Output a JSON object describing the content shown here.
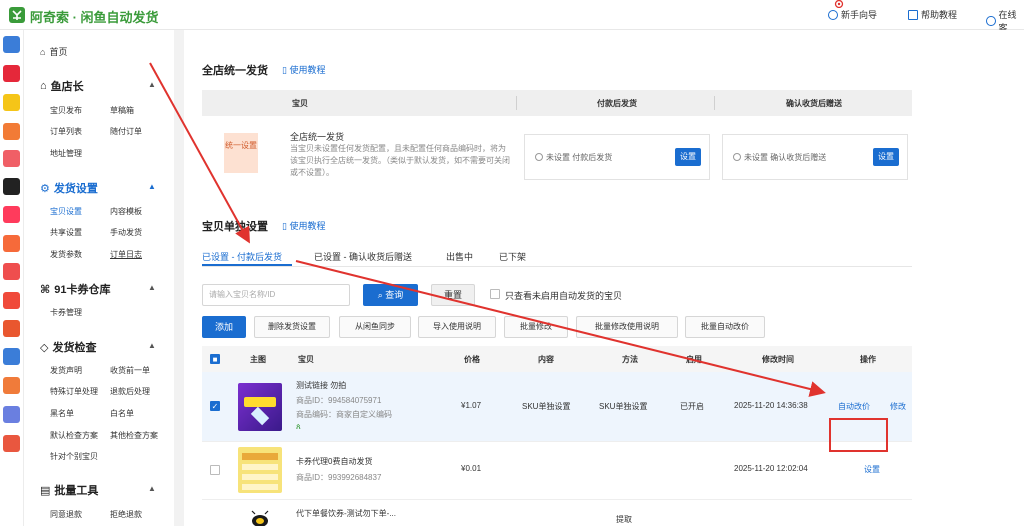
{
  "header": {
    "title": "阿奇索 · 闲鱼自动发货",
    "links": [
      "新手向导",
      "帮助教程",
      "在线客"
    ]
  },
  "rail_icons": [
    "app-grid-icon",
    "fish-app-icon",
    "goofish-icon",
    "taobao-icon",
    "store-icon",
    "douyin-icon",
    "xiaohongshu-icon",
    "pdd-icon",
    "like-icon",
    "shop-icon",
    "red-app-icon",
    "circle-app-icon",
    "box-app-icon",
    "tag-app-icon",
    "refresh-app-icon"
  ],
  "sidebar": {
    "home": "首页",
    "sections": [
      {
        "title": "鱼店长",
        "items": [
          "宝贝发布",
          "草稿箱",
          "订单列表",
          "随付订单",
          "地址管理"
        ]
      },
      {
        "title": "发货设置",
        "items": [
          "宝贝设置",
          "内容模板",
          "共享设置",
          "手动发货",
          "发货参数",
          "订单日志"
        ]
      },
      {
        "title": "91卡券仓库",
        "items": [
          "卡券管理"
        ]
      },
      {
        "title": "发货检查",
        "items": [
          "发货声明",
          "收货前一单",
          "特殊订单处理",
          "退款后处理",
          "黑名单",
          "白名单",
          "默认检查方案",
          "其他检查方案",
          "针对个别宝贝"
        ]
      },
      {
        "title": "批量工具",
        "items": [
          "同意退款",
          "拒绝退款"
        ]
      }
    ]
  },
  "unified": {
    "title": "全店统一发货",
    "help": "使用教程",
    "headers": [
      "宝贝",
      "付款后发货",
      "确认收货后赠送"
    ],
    "badge": "统一设置",
    "item_title": "全店统一发货",
    "item_desc": "当宝贝未设置任何发货配置，且未配置任何商品编码时，将为该宝贝执行全店统一发货。（类似于默认发货，如不需要可关闭或不设置）。",
    "box1_text": "未设置 付款后发货",
    "box2_text": "未设置 确认收货后赠送",
    "set_label": "设置"
  },
  "single": {
    "title": "宝贝单独设置",
    "help": "使用教程",
    "tabs": [
      "已设置 - 付款后发货",
      "已设置 - 确认收货后赠送",
      "出售中",
      "已下架"
    ],
    "search_placeholder": "请输入宝贝名称/ID",
    "query": "查询",
    "reset": "重置",
    "only_unused": "只查看未启用自动发货的宝贝",
    "toolbar": [
      "添加",
      "删除发货设置",
      "从闲鱼同步",
      "导入使用说明",
      "批量修改",
      "批量修改使用说明",
      "批量自动改价"
    ]
  },
  "table": {
    "columns": [
      "主图",
      "宝贝",
      "价格",
      "内容",
      "方法",
      "启用",
      "修改时间",
      "操作"
    ],
    "rows": [
      {
        "title": "测试链接 勿拍",
        "id": "商品ID：994584075971",
        "code": "商品编码：商家自定义编码",
        "price": "¥1.07",
        "content": "SKU单独设置",
        "method": "SKU单独设置",
        "enabled": "已开启",
        "time": "2025-11-20 14:36:38",
        "action1": "自动改价",
        "action2": "修改",
        "checked": true
      },
      {
        "title": "卡券代理0费自动发货",
        "id": "商品ID：993992684837",
        "code": "",
        "price": "¥0.01",
        "content": "",
        "method": "",
        "enabled": "",
        "time": "2025-11-20 12:02:04",
        "action1": "设置",
        "action2": "",
        "checked": false
      },
      {
        "title": "代下单餐饮券-测试勿下单-...",
        "id": "",
        "code": "",
        "price": "",
        "content": "",
        "method": "提取",
        "enabled": "",
        "time": "",
        "action1": "",
        "action2": "",
        "checked": false
      }
    ]
  },
  "colors": {
    "accent": "#1a6dd0",
    "highlight": "#e0332e",
    "brand": "#3a9b3a"
  }
}
